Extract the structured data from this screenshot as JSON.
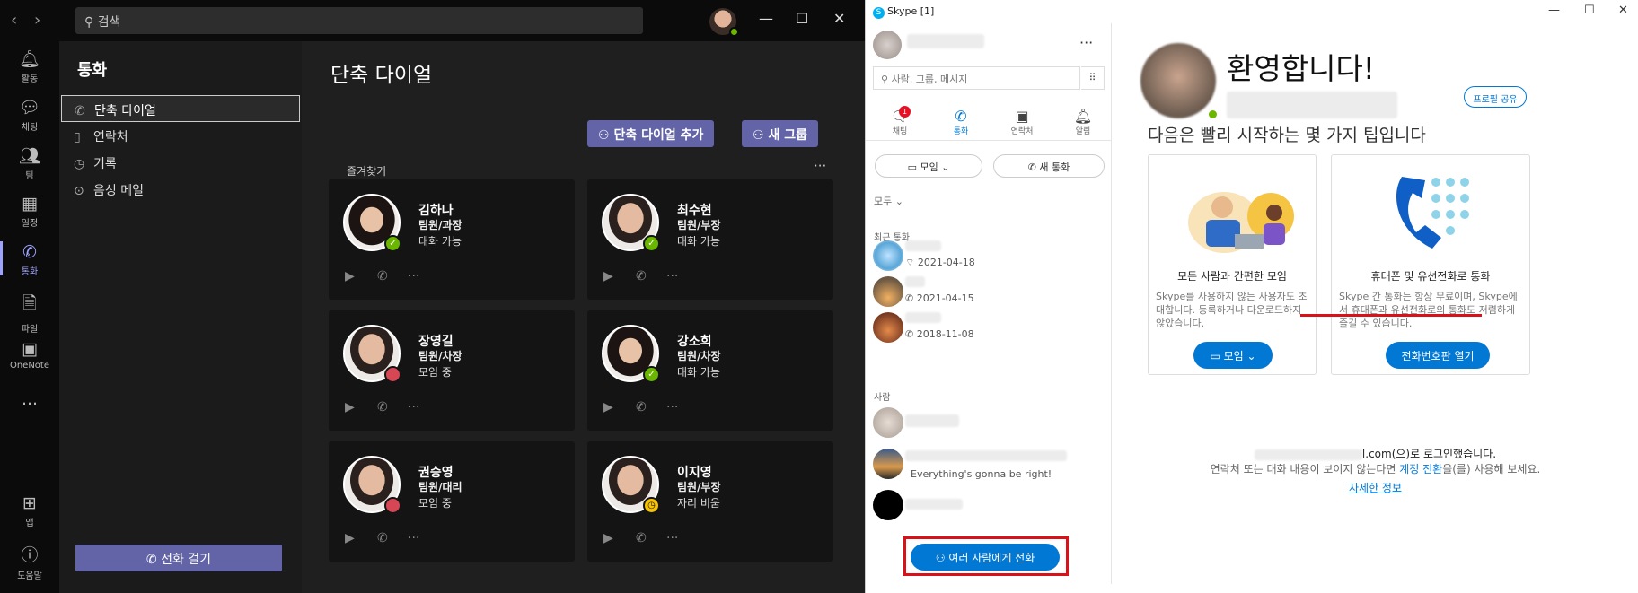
{
  "teams": {
    "search_placeholder": "검색",
    "rail": [
      {
        "label": "활동",
        "icon": "bell-icon"
      },
      {
        "label": "채팅",
        "icon": "chat-icon"
      },
      {
        "label": "팀",
        "icon": "team-icon"
      },
      {
        "label": "일정",
        "icon": "calendar-icon"
      },
      {
        "label": "통화",
        "icon": "phone-icon"
      },
      {
        "label": "파일",
        "icon": "file-icon"
      },
      {
        "label": "OneNote",
        "icon": "onenote-icon"
      },
      {
        "label": "...",
        "icon": "more-icon"
      },
      {
        "label": "앱",
        "icon": "apps-icon"
      },
      {
        "label": "도움말",
        "icon": "help-icon"
      }
    ],
    "side": {
      "title": "통화",
      "items": [
        {
          "label": "단축 다이얼"
        },
        {
          "label": "연락처"
        },
        {
          "label": "기록"
        },
        {
          "label": "음성 메일"
        }
      ],
      "call_button": "전화 걸기"
    },
    "main": {
      "title": "단축 다이얼",
      "add_speed_dial": "단축 다이얼 추가",
      "new_group": "새 그룹",
      "favorites_label": "즐겨찾기",
      "contacts": [
        {
          "name": "김하나",
          "role": "팀원/과장",
          "status": "대화 가능",
          "presence": "available"
        },
        {
          "name": "최수현",
          "role": "팀원/부장",
          "status": "대화 가능",
          "presence": "available"
        },
        {
          "name": "장영길",
          "role": "팀원/차장",
          "status": "모임 중",
          "presence": "busy"
        },
        {
          "name": "강소희",
          "role": "팀원/차장",
          "status": "대화 가능",
          "presence": "available"
        },
        {
          "name": "권승영",
          "role": "팀원/대리",
          "status": "모임 중",
          "presence": "busy"
        },
        {
          "name": "이지영",
          "role": "팀원/부장",
          "status": "자리 비움",
          "presence": "away"
        }
      ]
    }
  },
  "skype": {
    "window_title": "Skype [1]",
    "search_placeholder": "사람, 그룹, 메시지",
    "tabs": [
      {
        "label": "채팅",
        "badge": "1"
      },
      {
        "label": "통화"
      },
      {
        "label": "연락처"
      },
      {
        "label": "알림"
      }
    ],
    "meeting_button": "모임",
    "new_call_button": "새 통화",
    "filter": "모두",
    "recent_label": "최근 통화",
    "recent_calls": [
      {
        "date": "2021-04-18"
      },
      {
        "date": "2021-04-15"
      },
      {
        "date": "2018-11-08"
      }
    ],
    "people_label": "사람",
    "people_status_quote": "Everything's gonna be right!",
    "call_multiple": "여러 사람에게 전화",
    "welcome_title": "환영합니다!",
    "share_profile": "프로필 공유",
    "tips_title": "다음은 빨리 시작하는 몇 가지 팁입니다",
    "tip1": {
      "title": "모든 사람과 간편한 모임",
      "body": "Skype를 사용하지 않는 사용자도 초대합니다. 등록하거나 다운로드하지 않았습니다.",
      "button": "모임"
    },
    "tip2": {
      "title": "휴대폰 및 유선전화로 통화",
      "body": "Skype 간 통화는 항상 무료이며, Skype에서 휴대폰과 유선전화로의 통화도 저렴하게 즐길 수 있습니다.",
      "button": "전화번호판 열기"
    },
    "login_suffix": "l.com(으)로 로그인했습니다.",
    "login_hint_pre": "연락처 또는 대화 내용이 보이지 않는다면 ",
    "login_hint_link": "계정 전환",
    "login_hint_post": "을(를) 사용해 보세요.",
    "learn_more": "자세한 정보"
  },
  "colors": {
    "teams_accent": "#6264a7",
    "skype_blue": "#0078d4",
    "highlight_red": "#d9121a",
    "available": "#6bb700",
    "busy": "#d74654",
    "away": "#f8c300"
  }
}
